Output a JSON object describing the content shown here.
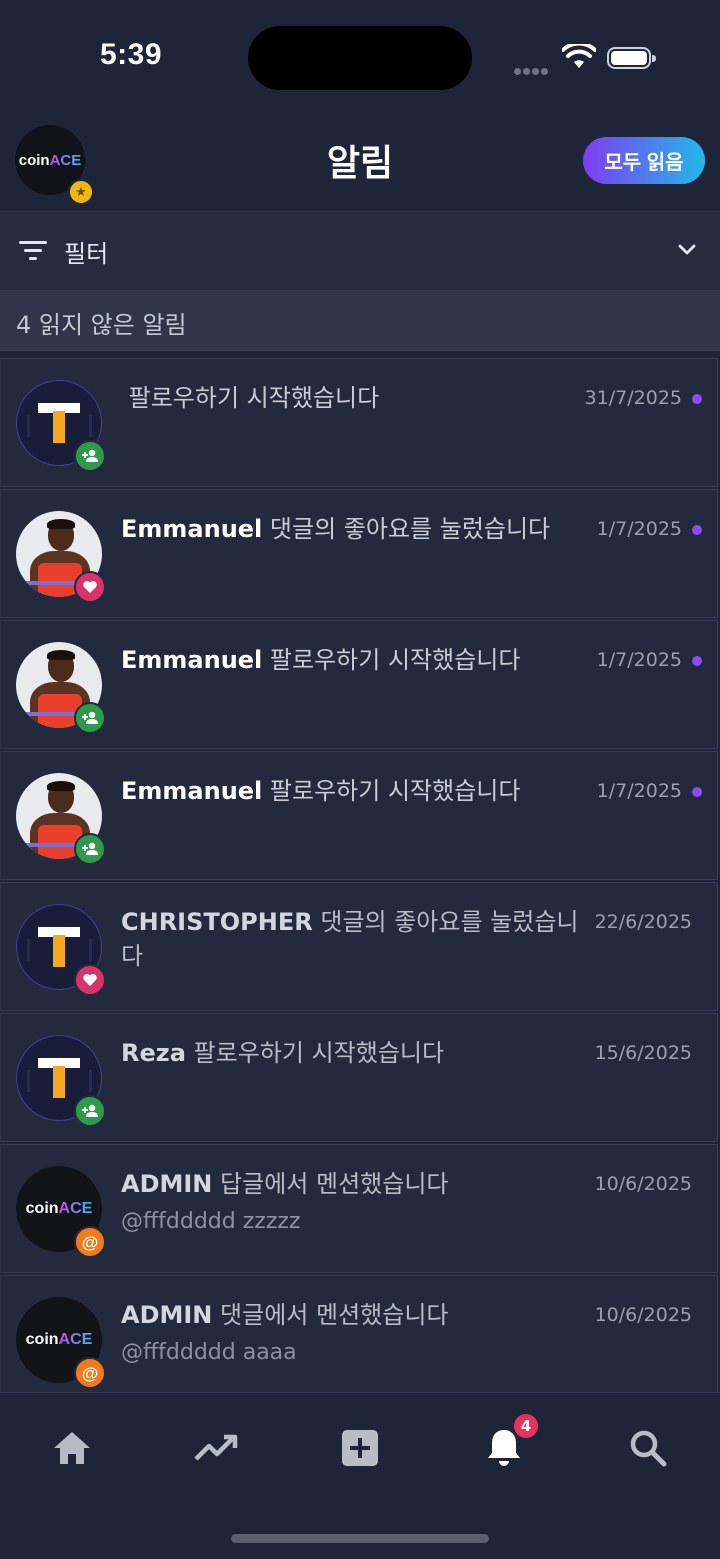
{
  "status_bar": {
    "time": "5:39"
  },
  "header": {
    "logo": {
      "coin": "coin",
      "ace": "ACE"
    },
    "title": "알림",
    "read_all_label": "모두 읽음"
  },
  "filter": {
    "label": "필터"
  },
  "unread_summary": "4 읽지 않은 알림",
  "notifications": [
    {
      "actor": "",
      "action": "팔로우하기 시작했습니다",
      "date": "31/7/2025",
      "unread": true,
      "avatar": "t-logo",
      "badge": "follow"
    },
    {
      "actor": "Emmanuel",
      "action": "댓글의 좋아요를 눌렀습니다",
      "date": "1/7/2025",
      "unread": true,
      "avatar": "photo",
      "badge": "like"
    },
    {
      "actor": "Emmanuel",
      "action": "팔로우하기 시작했습니다",
      "date": "1/7/2025",
      "unread": true,
      "avatar": "photo",
      "badge": "follow"
    },
    {
      "actor": "Emmanuel",
      "action": "팔로우하기 시작했습니다",
      "date": "1/7/2025",
      "unread": true,
      "avatar": "photo",
      "badge": "follow"
    },
    {
      "actor": "CHRISTOPHER",
      "action": "댓글의 좋아요를 눌렀습니다",
      "date": "22/6/2025",
      "unread": false,
      "avatar": "t-logo",
      "badge": "like"
    },
    {
      "actor": "Reza",
      "action": "팔로우하기 시작했습니다",
      "date": "15/6/2025",
      "unread": false,
      "avatar": "t-logo",
      "badge": "follow"
    },
    {
      "actor": "ADMIN",
      "action": "답글에서 멘션했습니다",
      "sub": "@fffddddd zzzzz",
      "date": "10/6/2025",
      "unread": false,
      "avatar": "coinace",
      "badge": "mention"
    },
    {
      "actor": "ADMIN",
      "action": "댓글에서 멘션했습니다",
      "sub": "@fffddddd aaaa",
      "date": "10/6/2025",
      "unread": false,
      "avatar": "coinace",
      "badge": "mention"
    }
  ],
  "bottom_nav": {
    "items": [
      "home-icon",
      "trending-icon",
      "add-post-icon",
      "notifications-icon",
      "search-icon"
    ],
    "notification_count": "4"
  },
  "colors": {
    "background": "#1f2538",
    "accent_gradient_start": "#7e3df0",
    "accent_gradient_end": "#22b8e8",
    "unread_dot": "#8b4ef0",
    "follow_badge": "#2e9a4a",
    "like_badge": "#d8336b",
    "mention_badge": "#f07a1c"
  }
}
